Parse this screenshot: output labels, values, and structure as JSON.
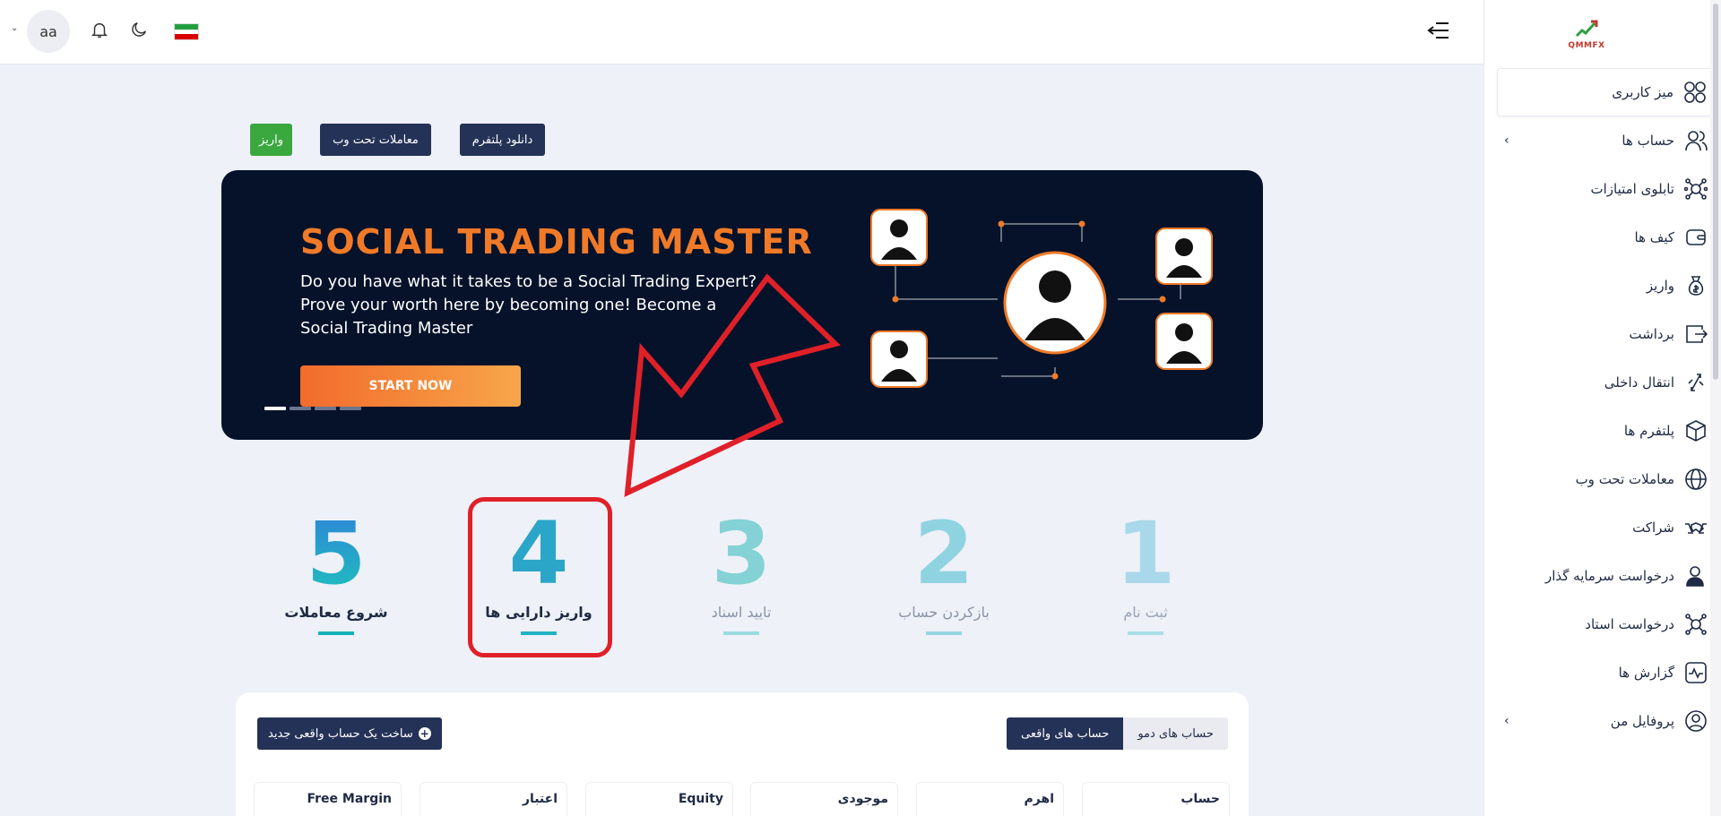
{
  "header": {
    "avatar_text": "aa",
    "icons": [
      "chevron-down-icon",
      "bell-icon",
      "moon-icon",
      "iran-flag-icon",
      "menu-collapse-icon"
    ]
  },
  "sidebar": {
    "logo_text": "QMMFX",
    "items": [
      {
        "label": "میز کاربری",
        "icon": "dashboard-icon"
      },
      {
        "label": "حساب ها",
        "icon": "users-icon",
        "has_submenu": true
      },
      {
        "label": "تابلوی امتیازات",
        "icon": "network-icon"
      },
      {
        "label": "کیف ها",
        "icon": "wallet-icon"
      },
      {
        "label": "واریز",
        "icon": "money-bag-icon"
      },
      {
        "label": "برداشت",
        "icon": "withdraw-icon"
      },
      {
        "label": "انتقال داخلی",
        "icon": "transfer-icon"
      },
      {
        "label": "پلتفرم ها",
        "icon": "box-icon"
      },
      {
        "label": "معاملات تحت وب",
        "icon": "globe-icon"
      },
      {
        "label": "شراکت",
        "icon": "handshake-icon"
      },
      {
        "label": "درخواست سرمایه گذار",
        "icon": "investor-icon"
      },
      {
        "label": "درخواست استاد",
        "icon": "network-icon"
      },
      {
        "label": "گزارش ها",
        "icon": "pulse-icon"
      },
      {
        "label": "پروفایل من",
        "icon": "profile-icon",
        "has_submenu": true
      }
    ]
  },
  "actions": {
    "download_platform": "دانلود پلتفرم",
    "web_trading": "معاملات تحت وب",
    "deposit": "واریز"
  },
  "banner": {
    "title": "SOCIAL TRADING MASTER",
    "text": "Do you have what it takes to be a Social Trading Expert? Prove your worth here by becoming one! Become a Social Trading Master",
    "cta": "START NOW",
    "slide_count": 4,
    "active_slide": 1
  },
  "steps": [
    {
      "num": "1",
      "label": "ثبت نام"
    },
    {
      "num": "2",
      "label": "بازکردن حساب"
    },
    {
      "num": "3",
      "label": "تایید اسناد"
    },
    {
      "num": "4",
      "label": "واریز دارایی ها"
    },
    {
      "num": "5",
      "label": "شروع معاملات"
    }
  ],
  "accounts": {
    "tabs": [
      "حساب های دمو",
      "حساب های واقعی"
    ],
    "active_tab": "حساب های واقعی",
    "new_account_button": "ساخت یک حساب واقعی جدید",
    "columns": [
      "حساب",
      "اهرم",
      "موجودی",
      "Equity",
      "اعتبار",
      "Free Margin"
    ]
  },
  "colors": {
    "navy": "#243257",
    "green": "#3aa83f",
    "banner_bg": "#05122a",
    "orange": "#f07a28",
    "highlight_red": "#e02028"
  }
}
